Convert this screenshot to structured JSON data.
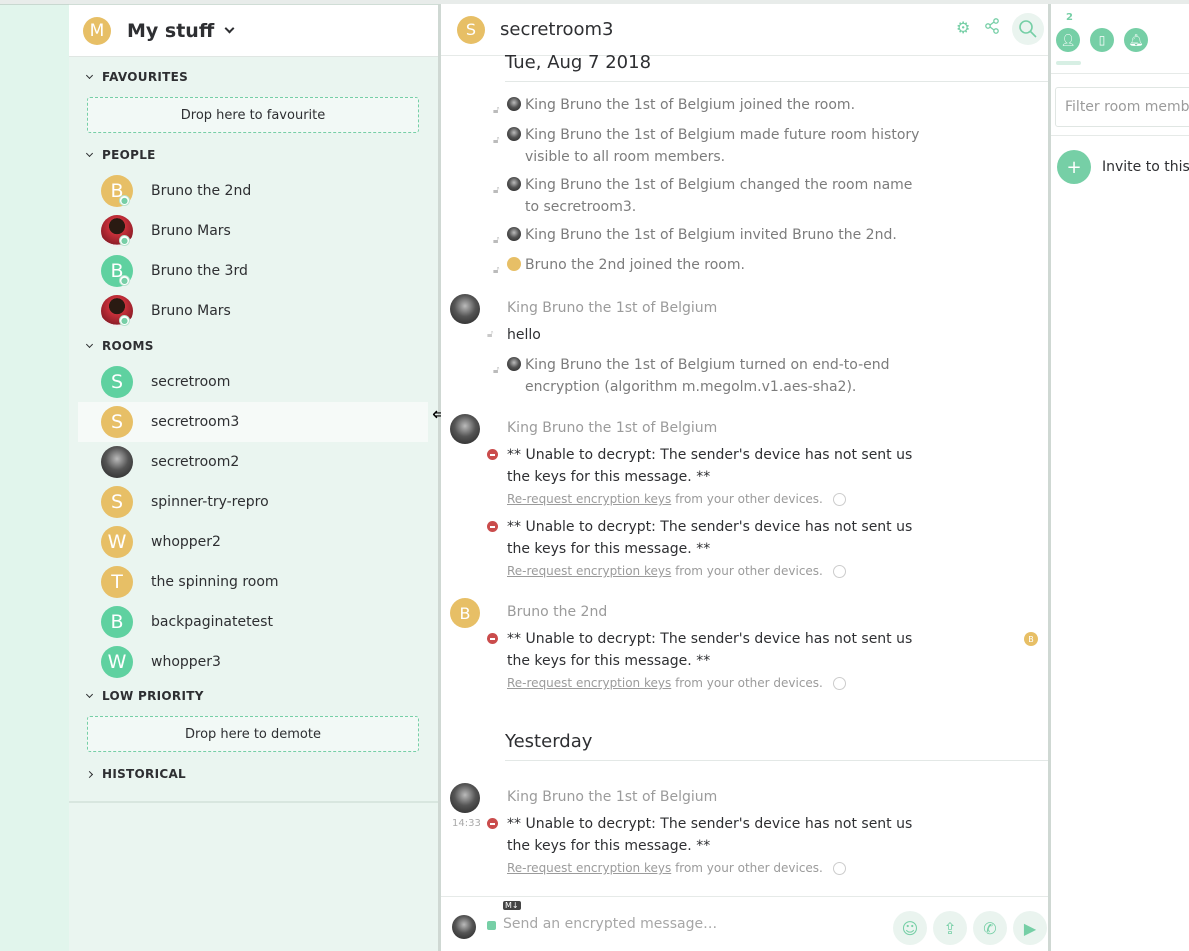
{
  "user_menu": {
    "avatar_letter": "M",
    "label": "My stuff"
  },
  "sections": {
    "favourites": "FAVOURITES",
    "favourites_drop": "Drop here to favourite",
    "people": "PEOPLE",
    "rooms": "ROOMS",
    "low_priority": "LOW PRIORITY",
    "low_priority_drop": "Drop here to demote",
    "historical": "HISTORICAL"
  },
  "people": [
    {
      "name": "Bruno the 2nd",
      "letter": "B"
    },
    {
      "name": "Bruno Mars",
      "letter": ""
    },
    {
      "name": "Bruno the 3rd",
      "letter": "B"
    },
    {
      "name": "Bruno Mars",
      "letter": ""
    }
  ],
  "rooms": [
    {
      "name": "secretroom",
      "letter": "S"
    },
    {
      "name": "secretroom3",
      "letter": "S"
    },
    {
      "name": "secretroom2",
      "letter": ""
    },
    {
      "name": "spinner-try-repro",
      "letter": "S"
    },
    {
      "name": "whopper2",
      "letter": "W"
    },
    {
      "name": "the spinning room",
      "letter": "T"
    },
    {
      "name": "backpaginatetest",
      "letter": "B"
    },
    {
      "name": "whopper3",
      "letter": "W"
    }
  ],
  "room": {
    "avatar_letter": "S",
    "title": "secretroom3"
  },
  "timeline": {
    "date1": "Tue, Aug 7 2018",
    "date2": "Yesterday",
    "events": [
      "King Bruno the 1st of Belgium joined the room.",
      "King Bruno the 1st of Belgium made future room history visible to all room members.",
      "King Bruno the 1st of Belgium changed the room name to secretroom3.",
      "King Bruno the 1st of Belgium invited Bruno the 2nd.",
      "Bruno the 2nd joined the room."
    ],
    "sender_king": "King Bruno the 1st of Belgium",
    "sender_bruno2": "Bruno the 2nd",
    "bruno2_letter": "B",
    "hello": "hello",
    "e2e_event": "King Bruno the 1st of Belgium turned on end-to-end encryption (algorithm m.megolm.v1.aes-sha2).",
    "undecryptable": "** Unable to decrypt: The sender's device has not sent us the keys for this message. **",
    "rerequest_link": "Re-request encryption keys",
    "rerequest_rest": " from your other devices.",
    "timestamp": "14:33"
  },
  "composer": {
    "placeholder": "Send an encrypted message…",
    "md_badge": "M↓"
  },
  "right_panel": {
    "member_count": "2",
    "filter_placeholder": "Filter room members",
    "invite_label": "Invite to this room"
  },
  "colors": {
    "accent": "#76cfa6",
    "orange_avatar": "#e7bf66",
    "green_avatar": "#5fd1a0",
    "error": "#ca4c4c"
  }
}
